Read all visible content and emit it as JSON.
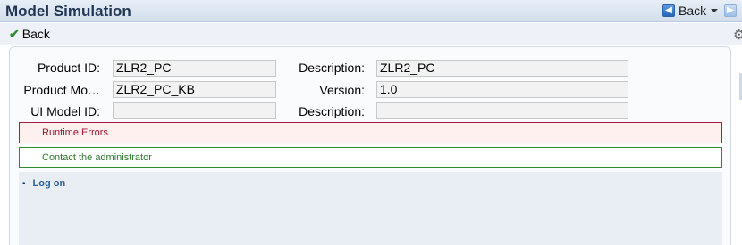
{
  "header": {
    "title": "Model Simulation",
    "back_label": "Back"
  },
  "toolbar": {
    "back_label": "Back"
  },
  "form": {
    "product_id_label": "Product ID:",
    "product_id_value": "ZLR2_PC",
    "description1_label": "Description:",
    "description1_value": "ZLR2_PC",
    "product_model_label": "Product Mo…",
    "product_model_value": "ZLR2_PC_KB",
    "version_label": "Version:",
    "version_value": "1.0",
    "ui_model_id_label": "UI Model ID:",
    "ui_model_id_value": "",
    "description2_label": "Description:",
    "description2_value": ""
  },
  "messages": {
    "error": "Runtime Errors",
    "info": "Contact the administrator"
  },
  "links": {
    "logon": "Log on"
  },
  "colors": {
    "title_text": "#1f3552",
    "error_border": "#a0203b",
    "success_border": "#2c8a2c",
    "link": "#2b5f9a"
  }
}
